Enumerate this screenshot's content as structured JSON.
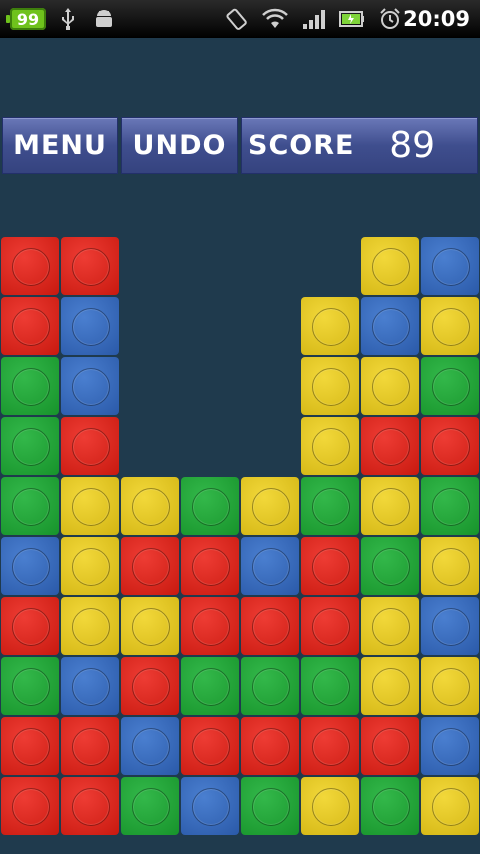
{
  "status_bar": {
    "battery_level": "99",
    "time": "20:09",
    "icons": [
      "usb-icon",
      "android-debug-icon",
      "screen-rotate-icon",
      "wifi-icon",
      "signal-icon",
      "battery-icon",
      "alarm-icon"
    ]
  },
  "toolbar": {
    "menu_label": "MENU",
    "undo_label": "UNDO",
    "score_label": "SCORE",
    "score_value": "89"
  },
  "colors": {
    "background": "#1f3a4d",
    "red": "#d8251b",
    "blue": "#3468b8",
    "green": "#22a23a",
    "yellow": "#e2c41f",
    "button": "#44539a"
  },
  "board": {
    "columns": 8,
    "rows": 10,
    "grid": [
      [
        "red",
        "red",
        "",
        "",
        "",
        "",
        "yellow",
        "blue"
      ],
      [
        "red",
        "blue",
        "",
        "",
        "",
        "yellow",
        "blue",
        "yellow"
      ],
      [
        "green",
        "blue",
        "",
        "",
        "",
        "yellow",
        "yellow",
        "green"
      ],
      [
        "green",
        "red",
        "",
        "",
        "",
        "yellow",
        "red",
        "red"
      ],
      [
        "green",
        "yellow",
        "yellow",
        "green",
        "yellow",
        "green",
        "yellow",
        "green"
      ],
      [
        "blue",
        "yellow",
        "red",
        "red",
        "blue",
        "red",
        "green",
        "yellow"
      ],
      [
        "red",
        "yellow",
        "yellow",
        "red",
        "red",
        "red",
        "yellow",
        "blue"
      ],
      [
        "green",
        "blue",
        "red",
        "green",
        "green",
        "green",
        "yellow",
        "yellow"
      ],
      [
        "red",
        "red",
        "blue",
        "red",
        "red",
        "red",
        "red",
        "blue"
      ],
      [
        "red",
        "red",
        "green",
        "blue",
        "green",
        "yellow",
        "green",
        "yellow"
      ]
    ]
  }
}
